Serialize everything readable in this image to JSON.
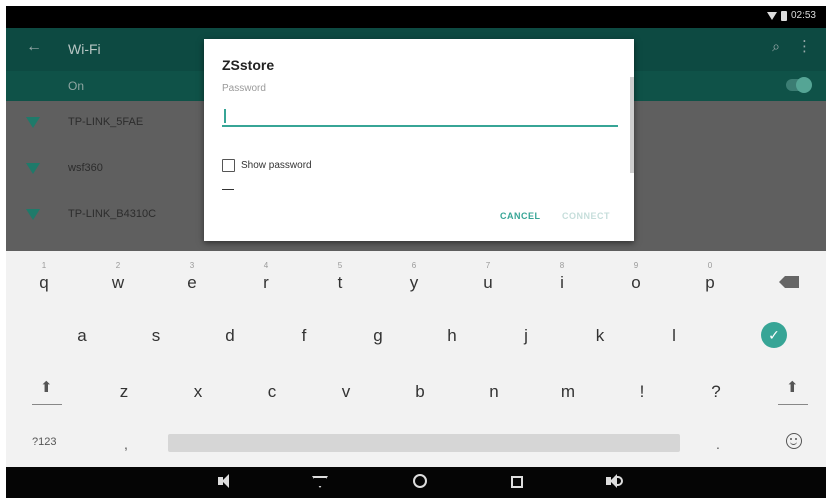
{
  "status_bar": {
    "time": "02:53"
  },
  "settings": {
    "title": "Wi-Fi",
    "wifi_state": "On",
    "networks": [
      "TP-LINK_5FAE",
      "wsf360",
      "TP-LINK_B4310C"
    ]
  },
  "dialog": {
    "title": "ZSstore",
    "password_label": "Password",
    "password_value": "",
    "show_password_label": "Show password",
    "show_password_checked": false,
    "cancel_label": "CANCEL",
    "connect_label": "CONNECT"
  },
  "keyboard": {
    "row1": [
      {
        "key": "q",
        "hint": "1"
      },
      {
        "key": "w",
        "hint": "2"
      },
      {
        "key": "e",
        "hint": "3"
      },
      {
        "key": "r",
        "hint": "4"
      },
      {
        "key": "t",
        "hint": "5"
      },
      {
        "key": "y",
        "hint": "6"
      },
      {
        "key": "u",
        "hint": "7"
      },
      {
        "key": "i",
        "hint": "8"
      },
      {
        "key": "o",
        "hint": "9"
      },
      {
        "key": "p",
        "hint": "0"
      }
    ],
    "row2": [
      "a",
      "s",
      "d",
      "f",
      "g",
      "h",
      "j",
      "k",
      "l"
    ],
    "row3": [
      "z",
      "x",
      "c",
      "v",
      "b",
      "n",
      "m",
      "!",
      "?"
    ],
    "symbols_label": "?123",
    "comma": ",",
    "period": "."
  },
  "colors": {
    "accent": "#37a596",
    "appbar": "#0d4a42",
    "navbar": "#050505"
  },
  "icons": {
    "status": [
      "wifi-icon",
      "battery-icon"
    ],
    "appbar": [
      "back-arrow-icon",
      "search-icon",
      "more-vert-icon"
    ],
    "navbar": [
      "volume-down-icon",
      "back-icon",
      "home-icon",
      "recents-icon",
      "volume-up-icon"
    ]
  }
}
